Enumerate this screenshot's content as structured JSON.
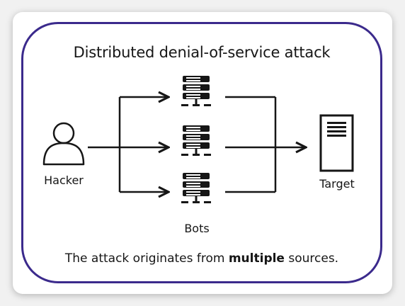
{
  "diagram": {
    "title": "Distributed denial-of-service attack",
    "nodes": {
      "hacker": {
        "label": "Hacker",
        "icon": "user-icon"
      },
      "bots": {
        "label": "Bots",
        "icon": "server-icon",
        "count": 3
      },
      "target": {
        "label": "Target",
        "icon": "document-server-icon"
      }
    },
    "caption": {
      "before": "The attack originates from ",
      "bold": "multiple",
      "after": " sources."
    },
    "colors": {
      "frame": "#3b2a8c",
      "stroke": "#161616"
    }
  }
}
